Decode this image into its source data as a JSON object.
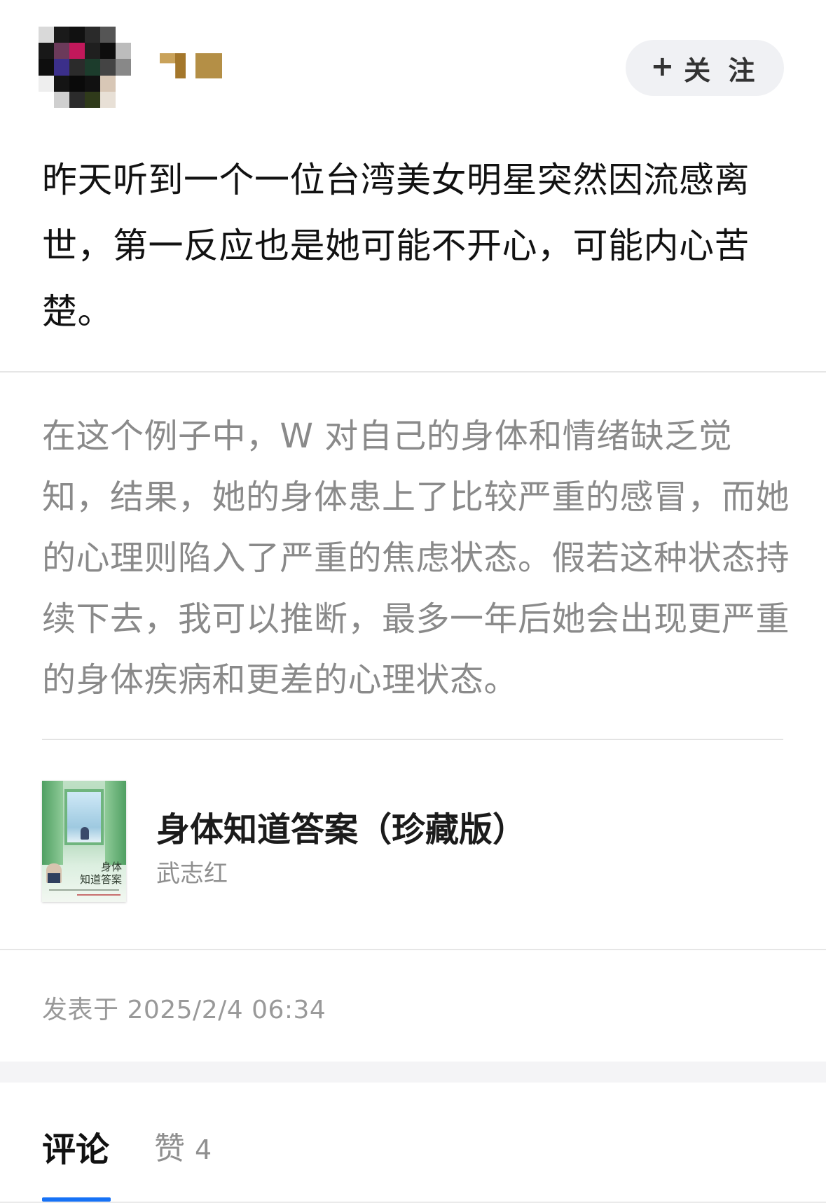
{
  "header": {
    "follow_button": {
      "icon": "plus-icon",
      "label": "关 注"
    }
  },
  "post": {
    "text": "昨天听到一个一位台湾美女明星突然因流感离世，第一反应也是她可能不开心，可能内心苦楚。",
    "quote": "在这个例子中，W 对自己的身体和情绪缺乏觉知，结果，她的身体患上了比较严重的感冒，而她的心理则陷入了严重的焦虑状态。假若这种状态持续下去，我可以推断，最多一年后她会出现更严重的身体疾病和更差的心理状态。"
  },
  "book": {
    "title": "身体知道答案（珍藏版）",
    "author": "武志红",
    "cover_title_line1": "身体",
    "cover_title_line2": "知道答案"
  },
  "meta": {
    "timestamp": "发表于 2025/2/4 06:34"
  },
  "tabs": {
    "comments_label": "评论",
    "likes_label": "赞",
    "likes_count": "4",
    "active_color": "#1772f6"
  }
}
